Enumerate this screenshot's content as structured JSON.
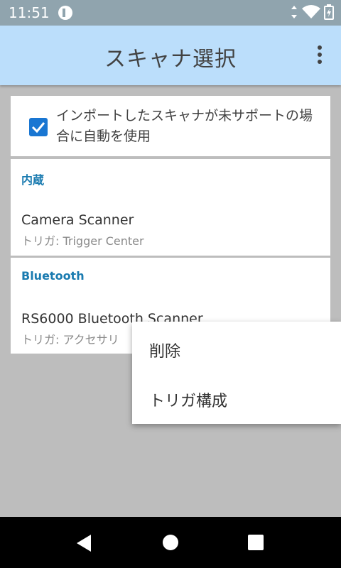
{
  "status_bar": {
    "time": "11:51",
    "icons": [
      "app-notification-icon",
      "signal-icon",
      "wifi-icon",
      "battery-charging-icon"
    ]
  },
  "app_bar": {
    "title": "スキャナ選択",
    "overflow_icon": "more-vert-icon"
  },
  "settings": {
    "auto_use_label": "インポートしたスキャナが未サポートの場合に自動を使用",
    "auto_use_checked": true
  },
  "sections": [
    {
      "header": "内蔵",
      "item_title": "Camera Scanner",
      "item_subtitle": "トリガ: Trigger Center"
    },
    {
      "header": "Bluetooth",
      "item_title": "RS6000 Bluetooth Scanner",
      "item_subtitle": "トリガ: アクセサリ"
    }
  ],
  "context_menu": {
    "items": [
      "削除",
      "トリガ構成"
    ]
  },
  "nav_bar": {
    "icons": [
      "back-icon",
      "home-icon",
      "recents-icon"
    ]
  },
  "colors": {
    "app_bar": "#bbdefb",
    "accent": "#1976d2",
    "section_header": "#1a7bb0",
    "scrim": "#bdbdbd"
  }
}
